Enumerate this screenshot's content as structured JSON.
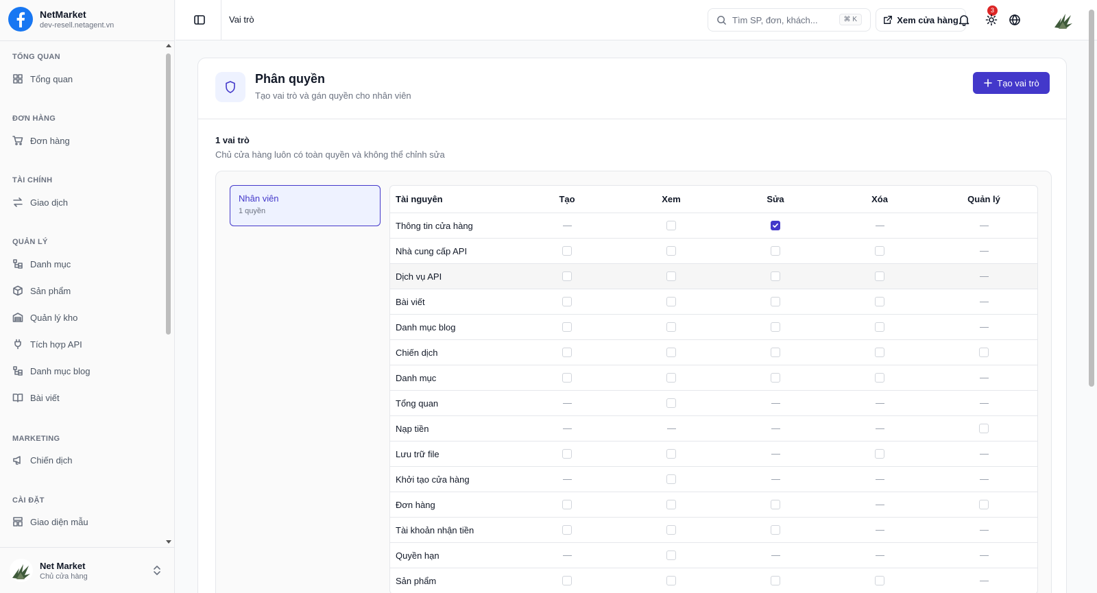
{
  "sidebar": {
    "brand_name": "NetMarket",
    "brand_domain": "dev-resell.netagent.vn",
    "sections": [
      {
        "title": "TỔNG QUAN",
        "items": [
          {
            "label": "Tổng quan",
            "icon": "dashboard-icon"
          }
        ]
      },
      {
        "title": "ĐƠN HÀNG",
        "items": [
          {
            "label": "Đơn hàng",
            "icon": "cart-icon"
          }
        ]
      },
      {
        "title": "TÀI CHÍNH",
        "items": [
          {
            "label": "Giao dịch",
            "icon": "transfer-icon"
          }
        ]
      },
      {
        "title": "QUẢN LÝ",
        "items": [
          {
            "label": "Danh mục",
            "icon": "category-icon"
          },
          {
            "label": "Sản phẩm",
            "icon": "box-icon"
          },
          {
            "label": "Quản lý kho",
            "icon": "warehouse-icon"
          },
          {
            "label": "Tích hợp API",
            "icon": "plug-icon"
          },
          {
            "label": "Danh mục blog",
            "icon": "category-icon"
          },
          {
            "label": "Bài viết",
            "icon": "book-icon"
          }
        ]
      },
      {
        "title": "MARKETING",
        "items": [
          {
            "label": "Chiến dịch",
            "icon": "megaphone-icon"
          }
        ]
      },
      {
        "title": "CÀI ĐẶT",
        "items": [
          {
            "label": "Giao diện mẫu",
            "icon": "template-icon"
          }
        ]
      }
    ],
    "footer": {
      "name": "Net Market",
      "role": "Chủ cửa hàng"
    }
  },
  "header": {
    "title": "Vai trò",
    "search_placeholder": "Tìm SP, đơn, khách...",
    "search_shortcut": "⌘ K",
    "view_store_label": "Xem cửa hàng",
    "notification_count": "3"
  },
  "main": {
    "title": "Phân quyền",
    "subtitle": "Tạo vai trò và gán quyền cho nhân viên",
    "create_button": "Tạo vai trò",
    "roles_count": "1 vai trò",
    "roles_note": "Chủ cửa hàng luôn có toàn quyền và không thể chỉnh sửa",
    "role": {
      "name": "Nhân viên",
      "permissions": "1 quyền"
    },
    "table": {
      "headers": [
        "Tài nguyên",
        "Tạo",
        "Xem",
        "Sửa",
        "Xóa",
        "Quản lý"
      ],
      "rows": [
        {
          "resource": "Thông tin cửa hàng",
          "cells": [
            "dash",
            "box",
            "checked",
            "dash",
            "dash"
          ]
        },
        {
          "resource": "Nhà cung cấp API",
          "cells": [
            "box",
            "box",
            "box",
            "box",
            "dash"
          ]
        },
        {
          "resource": "Dịch vụ API",
          "cells": [
            "box",
            "box",
            "box",
            "box",
            "dash"
          ]
        },
        {
          "resource": "Bài viết",
          "cells": [
            "box",
            "box",
            "box",
            "box",
            "dash"
          ]
        },
        {
          "resource": "Danh mục blog",
          "cells": [
            "box",
            "box",
            "box",
            "box",
            "dash"
          ]
        },
        {
          "resource": "Chiến dịch",
          "cells": [
            "box",
            "box",
            "box",
            "box",
            "box"
          ]
        },
        {
          "resource": "Danh mục",
          "cells": [
            "box",
            "box",
            "box",
            "box",
            "dash"
          ]
        },
        {
          "resource": "Tổng quan",
          "cells": [
            "dash",
            "box",
            "dash",
            "dash",
            "dash"
          ]
        },
        {
          "resource": "Nạp tiền",
          "cells": [
            "dash",
            "dash",
            "dash",
            "dash",
            "box"
          ]
        },
        {
          "resource": "Lưu trữ file",
          "cells": [
            "box",
            "box",
            "dash",
            "box",
            "dash"
          ]
        },
        {
          "resource": "Khởi tạo cửa hàng",
          "cells": [
            "dash",
            "box",
            "dash",
            "dash",
            "dash"
          ]
        },
        {
          "resource": "Đơn hàng",
          "cells": [
            "box",
            "box",
            "box",
            "dash",
            "box"
          ]
        },
        {
          "resource": "Tài khoản nhận tiền",
          "cells": [
            "box",
            "box",
            "box",
            "dash",
            "dash"
          ]
        },
        {
          "resource": "Quyền hạn",
          "cells": [
            "dash",
            "box",
            "dash",
            "dash",
            "dash"
          ]
        },
        {
          "resource": "Sản phẩm",
          "cells": [
            "box",
            "box",
            "box",
            "box",
            "dash"
          ]
        }
      ]
    }
  },
  "colors": {
    "accent": "#4338ca",
    "accent_light": "#eef2ff",
    "badge": "#dc2626",
    "facebook_blue": "#1877f2"
  }
}
